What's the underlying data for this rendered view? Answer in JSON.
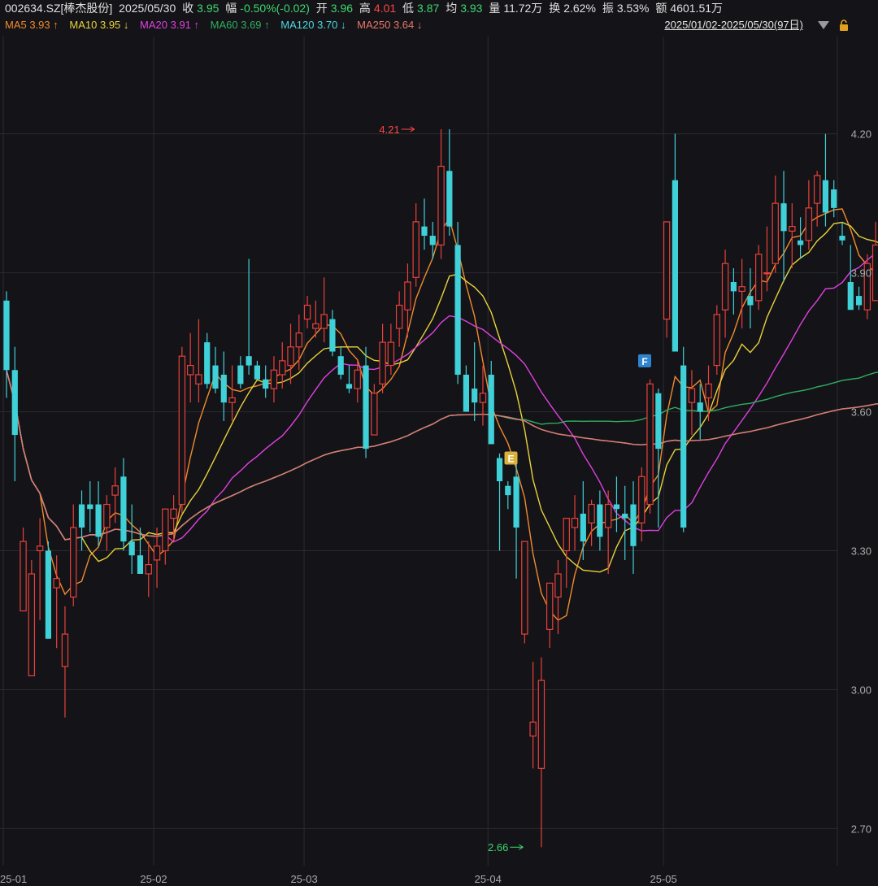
{
  "header": {
    "symbol": "002634.SZ[棒杰股份]",
    "date": "2025/05/30",
    "close_label": "收",
    "close_value": "3.95",
    "change_label": "幅",
    "change_value": "-0.50%(-0.02)",
    "open_label": "开",
    "open_value": "3.96",
    "high_label": "高",
    "high_value": "4.01",
    "low_label": "低",
    "low_value": "3.87",
    "avg_label": "均",
    "avg_value": "3.93",
    "volume_label": "量",
    "volume_value": "11.72万",
    "turnover_label": "换",
    "turnover_value": "2.62%",
    "amplitude_label": "振",
    "amplitude_value": "3.53%",
    "amount_label": "额",
    "amount_value": "4601.51万"
  },
  "ma_legend": [
    {
      "label": "MA5 3.93",
      "arrow": "↑",
      "color": "#f08a2e"
    },
    {
      "label": "MA10 3.95",
      "arrow": "↓",
      "color": "#e8d23a"
    },
    {
      "label": "MA20 3.91",
      "arrow": "↑",
      "color": "#e040e0"
    },
    {
      "label": "MA60 3.69",
      "arrow": "↑",
      "color": "#2fae5e"
    },
    {
      "label": "MA120 3.70",
      "arrow": "↓",
      "color": "#4fd6e0"
    },
    {
      "label": "MA250 3.64",
      "arrow": "↓",
      "color": "#e8746a"
    }
  ],
  "range_label": "2025/01/02-2025/05/30(97日)",
  "colors": {
    "up": "#e8403a",
    "down": "#3fd0d8",
    "grid": "#2a2a30",
    "axis_text": "#aaaaaa"
  },
  "chart_data": {
    "type": "candlestick",
    "y_ticks": [
      "4.20",
      "3.90",
      "3.60",
      "3.30",
      "3.00",
      "2.70"
    ],
    "ylim": [
      2.62,
      4.41
    ],
    "x_tick_labels": [
      {
        "label": "25-01",
        "index": 0
      },
      {
        "label": "25-02",
        "index": 18
      },
      {
        "label": "25-03",
        "index": 36
      },
      {
        "label": "25-04",
        "index": 58
      },
      {
        "label": "25-05",
        "index": 79
      }
    ],
    "annotations": [
      {
        "text": "4.21",
        "index": 49,
        "value": 4.21,
        "kind": "high"
      },
      {
        "text": "2.66",
        "index": 62,
        "value": 2.66,
        "kind": "low"
      },
      {
        "text": "E",
        "index": 59,
        "value": 3.5,
        "kind": "event",
        "color": "#d9b13b"
      },
      {
        "text": "F",
        "index": 75,
        "value": 3.71,
        "kind": "event",
        "color": "#2f84d0"
      }
    ],
    "ohlc": [
      [
        3.84,
        3.86,
        3.63,
        3.69
      ],
      [
        3.69,
        3.74,
        3.45,
        3.55
      ],
      [
        3.17,
        3.35,
        3.17,
        3.32
      ],
      [
        3.03,
        3.28,
        3.03,
        3.25
      ],
      [
        3.3,
        3.37,
        3.15,
        3.31
      ],
      [
        3.3,
        3.32,
        3.12,
        3.11
      ],
      [
        3.22,
        3.29,
        3.09,
        3.24
      ],
      [
        3.05,
        3.18,
        2.94,
        3.12
      ],
      [
        3.2,
        3.4,
        3.18,
        3.35
      ],
      [
        3.4,
        3.43,
        3.3,
        3.35
      ],
      [
        3.4,
        3.45,
        3.34,
        3.39
      ],
      [
        3.4,
        3.45,
        3.31,
        3.33
      ],
      [
        3.35,
        3.42,
        3.3,
        3.4
      ],
      [
        3.42,
        3.48,
        3.36,
        3.44
      ],
      [
        3.46,
        3.5,
        3.3,
        3.32
      ],
      [
        3.32,
        3.4,
        3.25,
        3.29
      ],
      [
        3.29,
        3.35,
        3.25,
        3.25
      ],
      [
        3.25,
        3.32,
        3.2,
        3.27
      ],
      [
        3.28,
        3.35,
        3.22,
        3.31
      ],
      [
        3.3,
        3.39,
        3.27,
        3.39
      ],
      [
        3.37,
        3.42,
        3.32,
        3.39
      ],
      [
        3.4,
        3.74,
        3.38,
        3.72
      ],
      [
        3.68,
        3.77,
        3.62,
        3.7
      ],
      [
        3.66,
        3.8,
        3.62,
        3.68
      ],
      [
        3.75,
        3.77,
        3.65,
        3.66
      ],
      [
        3.7,
        3.74,
        3.64,
        3.65
      ],
      [
        3.68,
        3.73,
        3.58,
        3.62
      ],
      [
        3.62,
        3.7,
        3.58,
        3.63
      ],
      [
        3.7,
        3.72,
        3.65,
        3.66
      ],
      [
        3.72,
        3.93,
        3.68,
        3.7
      ],
      [
        3.7,
        3.71,
        3.67,
        3.67
      ],
      [
        3.67,
        3.7,
        3.63,
        3.65
      ],
      [
        3.65,
        3.72,
        3.62,
        3.69
      ],
      [
        3.68,
        3.75,
        3.65,
        3.71
      ],
      [
        3.7,
        3.79,
        3.66,
        3.74
      ],
      [
        3.74,
        3.81,
        3.69,
        3.77
      ],
      [
        3.8,
        3.85,
        3.78,
        3.83
      ],
      [
        3.78,
        3.84,
        3.76,
        3.79
      ],
      [
        3.78,
        3.89,
        3.75,
        3.81
      ],
      [
        3.8,
        3.82,
        3.72,
        3.73
      ],
      [
        3.72,
        3.74,
        3.67,
        3.68
      ],
      [
        3.66,
        3.7,
        3.64,
        3.65
      ],
      [
        3.65,
        3.71,
        3.62,
        3.69
      ],
      [
        3.7,
        3.74,
        3.5,
        3.52
      ],
      [
        3.55,
        3.66,
        3.55,
        3.64
      ],
      [
        3.66,
        3.79,
        3.64,
        3.75
      ],
      [
        3.7,
        3.79,
        3.68,
        3.75
      ],
      [
        3.78,
        3.86,
        3.74,
        3.83
      ],
      [
        3.82,
        3.92,
        3.76,
        3.88
      ],
      [
        3.89,
        4.05,
        3.87,
        4.01
      ],
      [
        4.0,
        4.06,
        3.95,
        3.98
      ],
      [
        3.98,
        4.01,
        3.93,
        3.96
      ],
      [
        3.96,
        4.21,
        3.93,
        4.13
      ],
      [
        4.12,
        4.21,
        3.98,
        4.0
      ],
      [
        3.96,
        4.01,
        3.66,
        3.68
      ],
      [
        3.68,
        3.7,
        3.62,
        3.6
      ],
      [
        3.65,
        3.75,
        3.58,
        3.62
      ],
      [
        3.62,
        3.7,
        3.57,
        3.64
      ],
      [
        3.68,
        3.71,
        3.55,
        3.53
      ],
      [
        3.5,
        3.51,
        3.3,
        3.45
      ],
      [
        3.44,
        3.45,
        3.39,
        3.42
      ],
      [
        3.46,
        3.5,
        3.24,
        3.35
      ],
      [
        3.12,
        3.32,
        3.1,
        3.32
      ],
      [
        2.9,
        3.06,
        2.83,
        2.93
      ],
      [
        2.83,
        3.07,
        2.66,
        3.02
      ],
      [
        3.13,
        3.21,
        3.09,
        3.23
      ],
      [
        3.2,
        3.28,
        3.12,
        3.25
      ],
      [
        3.3,
        3.37,
        3.22,
        3.37
      ],
      [
        3.35,
        3.42,
        3.3,
        3.37
      ],
      [
        3.38,
        3.45,
        3.28,
        3.32
      ],
      [
        3.36,
        3.41,
        3.31,
        3.4
      ],
      [
        3.4,
        3.43,
        3.3,
        3.33
      ],
      [
        3.35,
        3.43,
        3.25,
        3.4
      ],
      [
        3.4,
        3.46,
        3.34,
        3.39
      ],
      [
        3.38,
        3.44,
        3.28,
        3.37
      ],
      [
        3.4,
        3.45,
        3.25,
        3.31
      ],
      [
        3.36,
        3.48,
        3.32,
        3.46
      ],
      [
        3.4,
        3.67,
        3.38,
        3.66
      ],
      [
        3.64,
        3.65,
        3.35,
        3.52
      ],
      [
        3.8,
        4.01,
        3.76,
        4.01
      ],
      [
        4.1,
        4.2,
        3.73,
        3.73
      ],
      [
        3.7,
        3.74,
        3.34,
        3.35
      ],
      [
        3.62,
        3.69,
        3.55,
        3.65
      ],
      [
        3.62,
        3.66,
        3.54,
        3.6
      ],
      [
        3.63,
        3.7,
        3.58,
        3.66
      ],
      [
        3.7,
        3.83,
        3.68,
        3.81
      ],
      [
        3.82,
        3.95,
        3.76,
        3.92
      ],
      [
        3.88,
        3.91,
        3.81,
        3.86
      ],
      [
        3.86,
        3.93,
        3.78,
        3.87
      ],
      [
        3.85,
        3.91,
        3.78,
        3.83
      ],
      [
        3.84,
        3.96,
        3.82,
        3.94
      ],
      [
        3.9,
        4.0,
        3.86,
        3.9
      ],
      [
        3.92,
        4.11,
        3.9,
        4.05
      ],
      [
        4.05,
        4.12,
        3.88,
        3.99
      ],
      [
        3.99,
        4.05,
        3.91,
        4.0
      ],
      [
        3.97,
        4.02,
        3.93,
        3.96
      ],
      [
        3.97,
        4.1,
        3.95,
        4.04
      ],
      [
        4.05,
        4.12,
        4.0,
        4.11
      ],
      [
        4.1,
        4.2,
        4.0,
        4.03
      ],
      [
        4.08,
        4.1,
        4.02,
        4.04
      ],
      [
        3.98,
        4.01,
        3.96,
        3.97
      ],
      [
        3.88,
        3.96,
        3.82,
        3.82
      ],
      [
        3.85,
        3.87,
        3.82,
        3.83
      ],
      [
        3.82,
        3.94,
        3.8,
        3.92
      ],
      [
        3.84,
        4.01,
        3.84,
        3.96
      ],
      [
        3.94,
        4.0,
        3.85,
        3.87
      ],
      [
        3.97,
        4.02,
        3.87,
        3.95
      ]
    ]
  }
}
